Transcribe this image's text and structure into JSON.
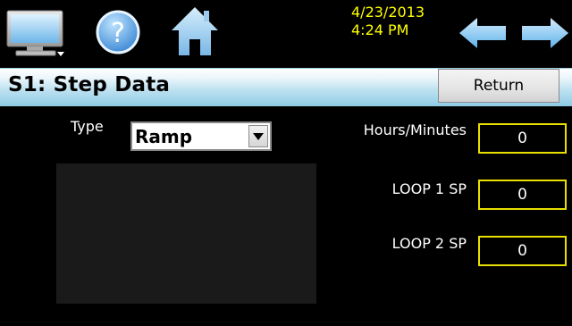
{
  "toolbar": {
    "icons": [
      "monitor-icon",
      "help-icon",
      "home-icon",
      "back-arrow-icon",
      "forward-arrow-icon"
    ],
    "date": "4/23/2013",
    "time": "4:24 PM"
  },
  "header": {
    "title": "S1: Step Data",
    "return_label": "Return"
  },
  "form": {
    "type_label": "Type",
    "type_value": "Ramp",
    "fields": [
      {
        "label": "Hours/Minutes",
        "value": "0"
      },
      {
        "label": "LOOP 1 SP",
        "value": "0"
      },
      {
        "label": "LOOP 2 SP",
        "value": "0"
      }
    ]
  },
  "colors": {
    "background": "#000000",
    "accent_text": "#ffff00",
    "field_border": "#e8e000",
    "title_bar": "#bfe2f1",
    "arrow": "#5fb2ea"
  }
}
